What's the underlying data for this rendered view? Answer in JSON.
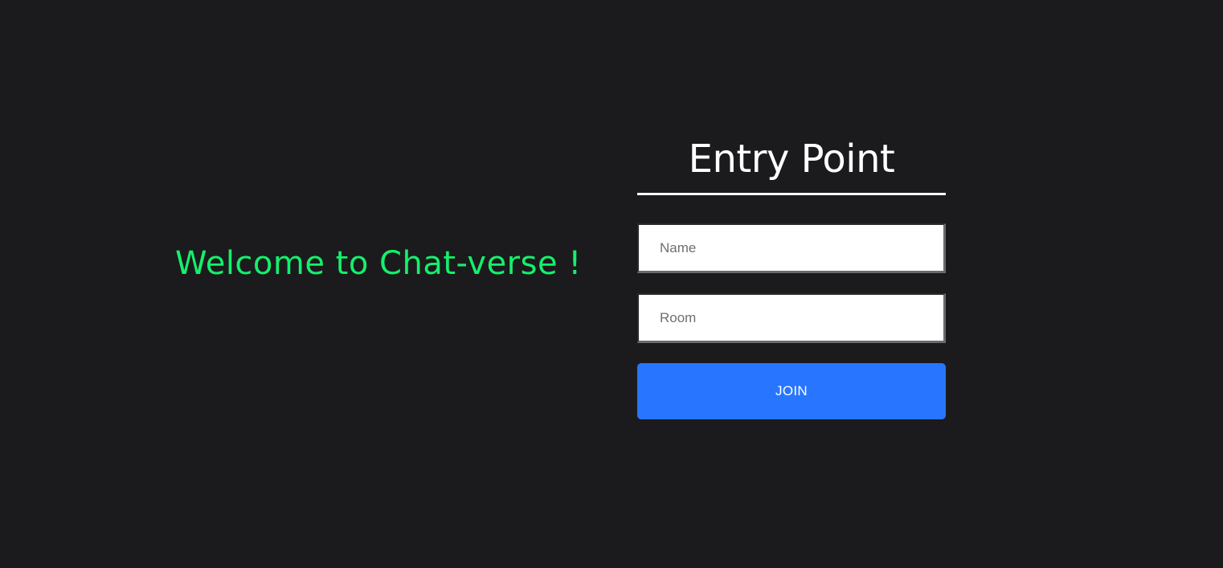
{
  "welcome": {
    "text": "Welcome to Chat-verse !"
  },
  "form": {
    "title": "Entry Point",
    "name_placeholder": "Name",
    "room_placeholder": "Room",
    "join_label": "JOIN"
  },
  "colors": {
    "background": "#1b1b1d",
    "welcome_text": "#14f06c",
    "join_button": "#2876ff"
  }
}
